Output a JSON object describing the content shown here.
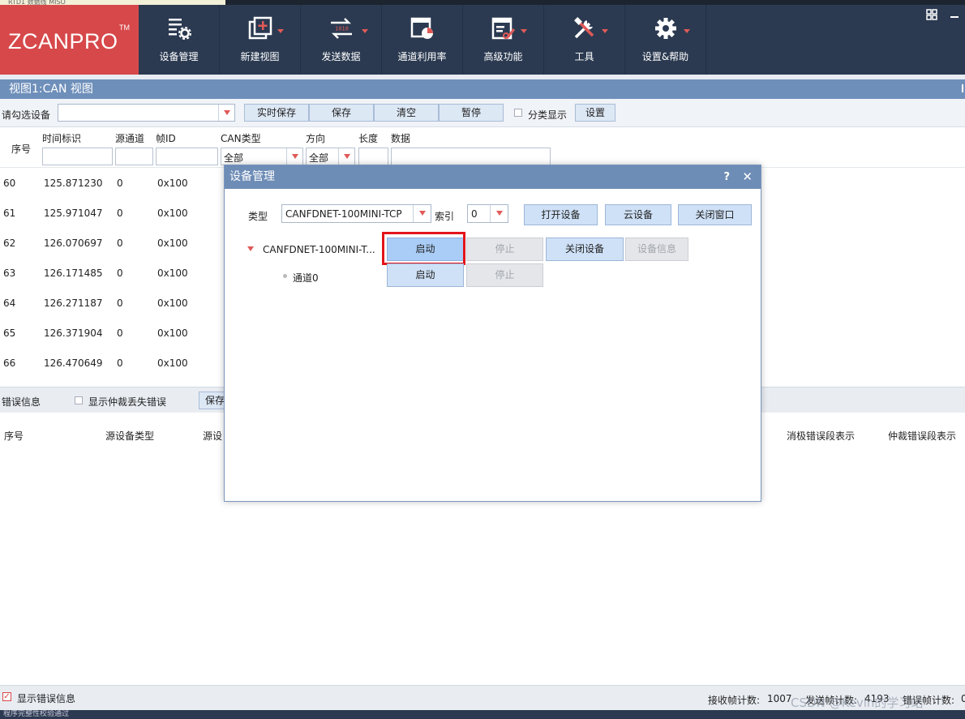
{
  "top_strip": {
    "text": "RTD1 数据线 MISO"
  },
  "brand": {
    "logo_text": "ZCANPRO",
    "trademark": "TM"
  },
  "ribbon": {
    "items": [
      {
        "label": "设备管理",
        "icon": "device-manage-icon",
        "dropdown": false
      },
      {
        "label": "新建视图",
        "icon": "new-view-icon",
        "dropdown": true
      },
      {
        "label": "发送数据",
        "icon": "send-data-icon",
        "dropdown": true
      },
      {
        "label": "通道利用率",
        "icon": "channel-usage-icon",
        "dropdown": false
      },
      {
        "label": "高级功能",
        "icon": "advanced-icon",
        "dropdown": true
      },
      {
        "label": "工具",
        "icon": "tools-icon",
        "dropdown": true
      },
      {
        "label": "设置&帮助",
        "icon": "gear-icon",
        "dropdown": true
      }
    ]
  },
  "view": {
    "title": "视图1:CAN 视图",
    "toolbar": {
      "select_label": "请勾选设备",
      "realtime_save": "实时保存",
      "save": "保存",
      "clear": "清空",
      "pause": "暂停",
      "classify_label": "分类显示",
      "settings": "设置"
    },
    "table": {
      "headers": {
        "seq": "序号",
        "time": "时间标识",
        "src_channel": "源通道",
        "frame_id": "帧ID",
        "can_type": "CAN类型",
        "direction": "方向",
        "length": "长度",
        "data": "数据"
      },
      "filters": {
        "can_type": "全部",
        "direction": "全部"
      },
      "rows": [
        {
          "seq": "60",
          "time": "125.871230",
          "channel": "0",
          "id": "0x100"
        },
        {
          "seq": "61",
          "time": "125.971047",
          "channel": "0",
          "id": "0x100"
        },
        {
          "seq": "62",
          "time": "126.070697",
          "channel": "0",
          "id": "0x100"
        },
        {
          "seq": "63",
          "time": "126.171485",
          "channel": "0",
          "id": "0x100"
        },
        {
          "seq": "64",
          "time": "126.271187",
          "channel": "0",
          "id": "0x100"
        },
        {
          "seq": "65",
          "time": "126.371904",
          "channel": "0",
          "id": "0x100"
        },
        {
          "seq": "66",
          "time": "126.470649",
          "channel": "0",
          "id": "0x100"
        }
      ]
    }
  },
  "error_panel": {
    "title": "错误信息",
    "show_arbitration_label": "显示仲裁丢失错误",
    "save": "保存",
    "headers": {
      "seq": "序号",
      "src_device_type": "源设备类型",
      "src_device": "源设",
      "passive_err": "消极错误段表示",
      "arb_err": "仲裁错误段表示"
    }
  },
  "status": {
    "show_errors_label": "显示错误信息",
    "rx_label": "接收帧计数:",
    "rx_value": "1007",
    "tx_label": "发送帧计数:",
    "tx_value": "4193",
    "err_label": "错误帧计数:",
    "err_value": "0",
    "watermark": "CSDN @Kevin的学习站",
    "bottom_text": "程序完整性校验通过"
  },
  "dialog": {
    "title": "设备管理",
    "help": "?",
    "close": "✕",
    "type_label": "类型",
    "type_value": "CANFDNET-100MINI-TCP",
    "index_label": "索引",
    "index_value": "0",
    "open_device": "打开设备",
    "cloud_device": "云设备",
    "close_window": "关闭窗口",
    "device_node": "CANFDNET-100MINI-T...",
    "start": "启动",
    "stop": "停止",
    "close_device": "关闭设备",
    "device_info": "设备信息",
    "channel_node": "通道0",
    "channel_start": "启动",
    "channel_stop": "停止"
  },
  "colors": {
    "ribbon_bg": "#2b3a51",
    "logo_bg": "#d7484a",
    "accent_arrow": "#e05a57",
    "highlight": "#e3141b",
    "title_bar": "#6d8cb6"
  }
}
